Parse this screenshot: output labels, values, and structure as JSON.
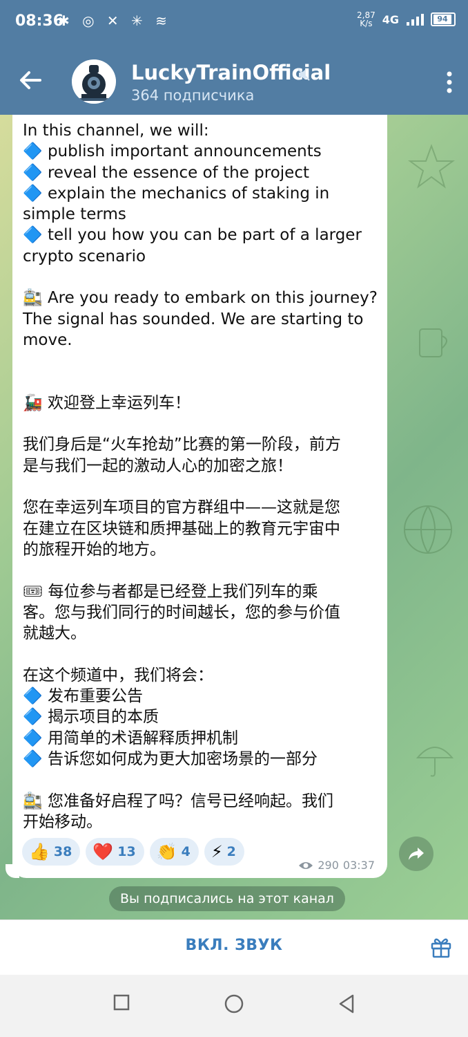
{
  "status_bar": {
    "time": "08:36",
    "icons": "✱ ◎ ✕ ✳ ≋",
    "speed_value": "2,87",
    "speed_unit": "K/s",
    "network": "4G",
    "battery": "94"
  },
  "header": {
    "title": "LuckyTrainOfficial",
    "subtitle": "364 подписчика",
    "accent": "#527da3"
  },
  "message": {
    "text": "In this channel, we will:\n🔷 publish important announcements\n🔷 reveal the essence of the project\n🔷 explain the mechanics of staking in\nsimple terms\n🔷 tell you how you can be part of a larger\ncrypto scenario\n\n🚉 Are you ready to embark on this journey?\nThe signal has sounded. We are starting to\nmove.\n\n\n🚂 欢迎登上幸运列车！\n\n我们身后是“火车抢劫”比赛的第一阶段，前方\n是与我们一起的激动人心的加密之旅！\n\n您在幸运列车项目的官方群组中——这就是您\n在建立在区块链和质押基础上的教育元宇宙中\n的旅程开始的地方。\n\n🎟 每位参与者都是已经登上我们列车的乘\n客。您与我们同行的时间越长，您的参与价值\n就越大。\n\n在这个频道中，我们将会：\n🔷 发布重要公告\n🔷 揭示项目的本质\n🔷 用简单的术语解释质押机制\n🔷 告诉您如何成为更大加密场景的一部分\n\n🚉 您准备好启程了吗？信号已经响起。我们\n开始移动。",
    "reactions": [
      {
        "emoji": "👍",
        "count": "38"
      },
      {
        "emoji": "❤️",
        "count": "13"
      },
      {
        "emoji": "👏",
        "count": "4"
      },
      {
        "emoji": "⚡",
        "count": "2"
      }
    ],
    "views": "290",
    "time": "03:37"
  },
  "service_message": "Вы подписались на этот канал",
  "bottom": {
    "unmute_label": "ВКЛ. ЗВУК"
  }
}
